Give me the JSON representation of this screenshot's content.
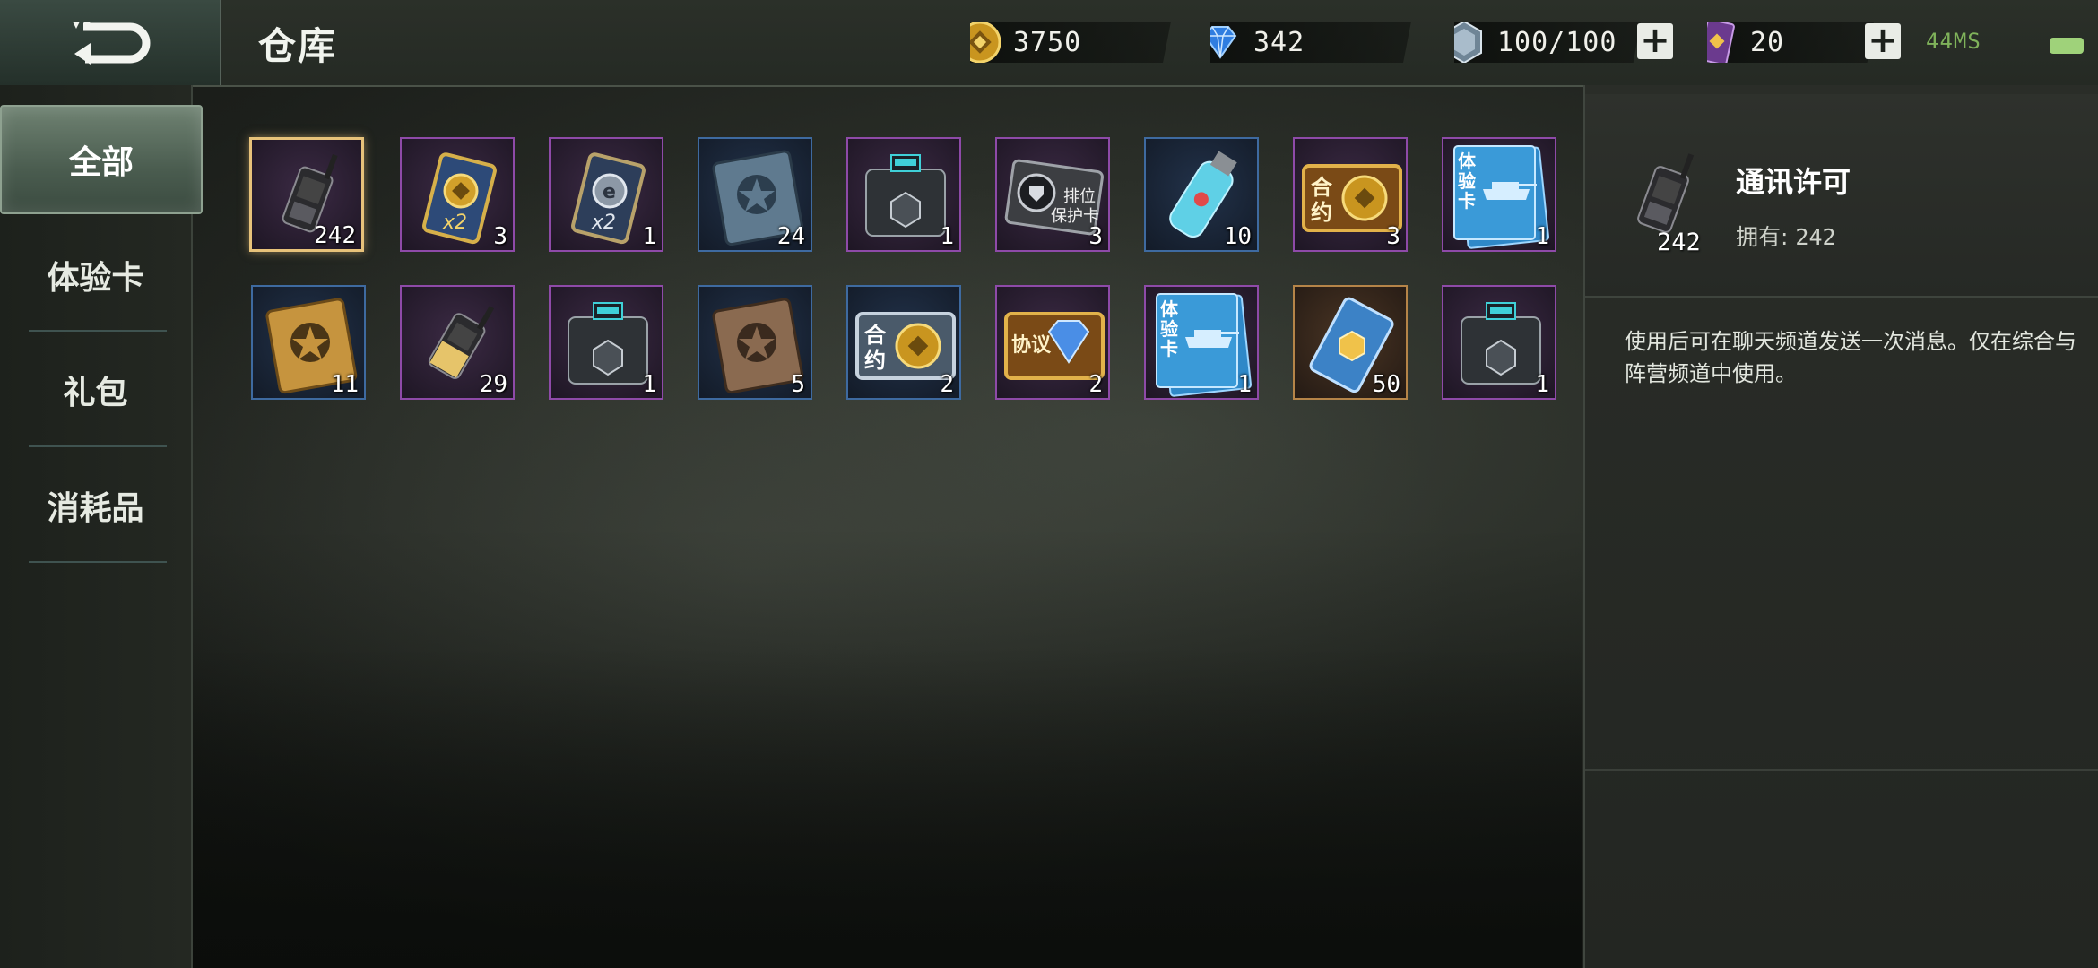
{
  "header": {
    "title": "仓库",
    "resources": [
      {
        "name": "gold-coin",
        "value": "3750"
      },
      {
        "name": "diamond",
        "value": "342"
      },
      {
        "name": "stamina-crystal",
        "value": "100/100"
      },
      {
        "name": "card-ticket",
        "value": "20"
      }
    ],
    "ping": "44MS",
    "battery_level": 1.0
  },
  "sidebar": {
    "tabs": [
      {
        "label": "全部",
        "active": true
      },
      {
        "label": "体验卡",
        "active": false
      },
      {
        "label": "礼包",
        "active": false
      },
      {
        "label": "消耗品",
        "active": false
      }
    ]
  },
  "items": [
    {
      "icon": "walkie-talkie-icon",
      "count": "242",
      "quality": "purple",
      "selected": true
    },
    {
      "icon": "gold-double-card-icon",
      "count": "3",
      "quality": "purple",
      "badge": "x2"
    },
    {
      "icon": "silver-double-card-icon",
      "count": "1",
      "quality": "purple",
      "badge": "x2"
    },
    {
      "icon": "blue-star-book-icon",
      "count": "24",
      "quality": "blue"
    },
    {
      "icon": "supply-crate-icon",
      "count": "1",
      "quality": "purple"
    },
    {
      "icon": "rank-protection-card-icon",
      "count": "3",
      "quality": "purple",
      "badge": "排位\n保护卡"
    },
    {
      "icon": "blue-canister-icon",
      "count": "10",
      "quality": "blue"
    },
    {
      "icon": "gold-contract-icon",
      "count": "3",
      "quality": "purple",
      "badge": "合约"
    },
    {
      "icon": "tank-trial-card-icon",
      "count": "1",
      "quality": "purple",
      "badge": "体验卡"
    },
    {
      "icon": "gold-star-book-icon",
      "count": "11",
      "quality": "blue"
    },
    {
      "icon": "gold-walkie-talkie-icon",
      "count": "29",
      "quality": "purple"
    },
    {
      "icon": "supply-crate-icon",
      "count": "1",
      "quality": "purple"
    },
    {
      "icon": "brown-star-book-icon",
      "count": "5",
      "quality": "blue"
    },
    {
      "icon": "silver-contract-icon",
      "count": "2",
      "quality": "blue",
      "badge": "合约"
    },
    {
      "icon": "diamond-agreement-icon",
      "count": "2",
      "quality": "purple",
      "badge": "协议"
    },
    {
      "icon": "tank-trial-card-icon",
      "count": "1",
      "quality": "purple",
      "badge": "体验卡"
    },
    {
      "icon": "blue-ticket-icon",
      "count": "50",
      "quality": "orange"
    },
    {
      "icon": "supply-crate-icon",
      "count": "1",
      "quality": "purple"
    }
  ],
  "detail": {
    "name": "通讯许可",
    "owned_label": "拥有:",
    "owned_count": "242",
    "icon_count": "242",
    "description": "使用后可在聊天频道发送一次消息。仅在综合与阵营频道中使用。"
  },
  "colors": {
    "accent_green": "#7fb25a",
    "quality_purple": "#8e4aa8",
    "quality_blue": "#3e6aa0",
    "quality_orange": "#b58448",
    "selected_border": "#e7c27a"
  }
}
